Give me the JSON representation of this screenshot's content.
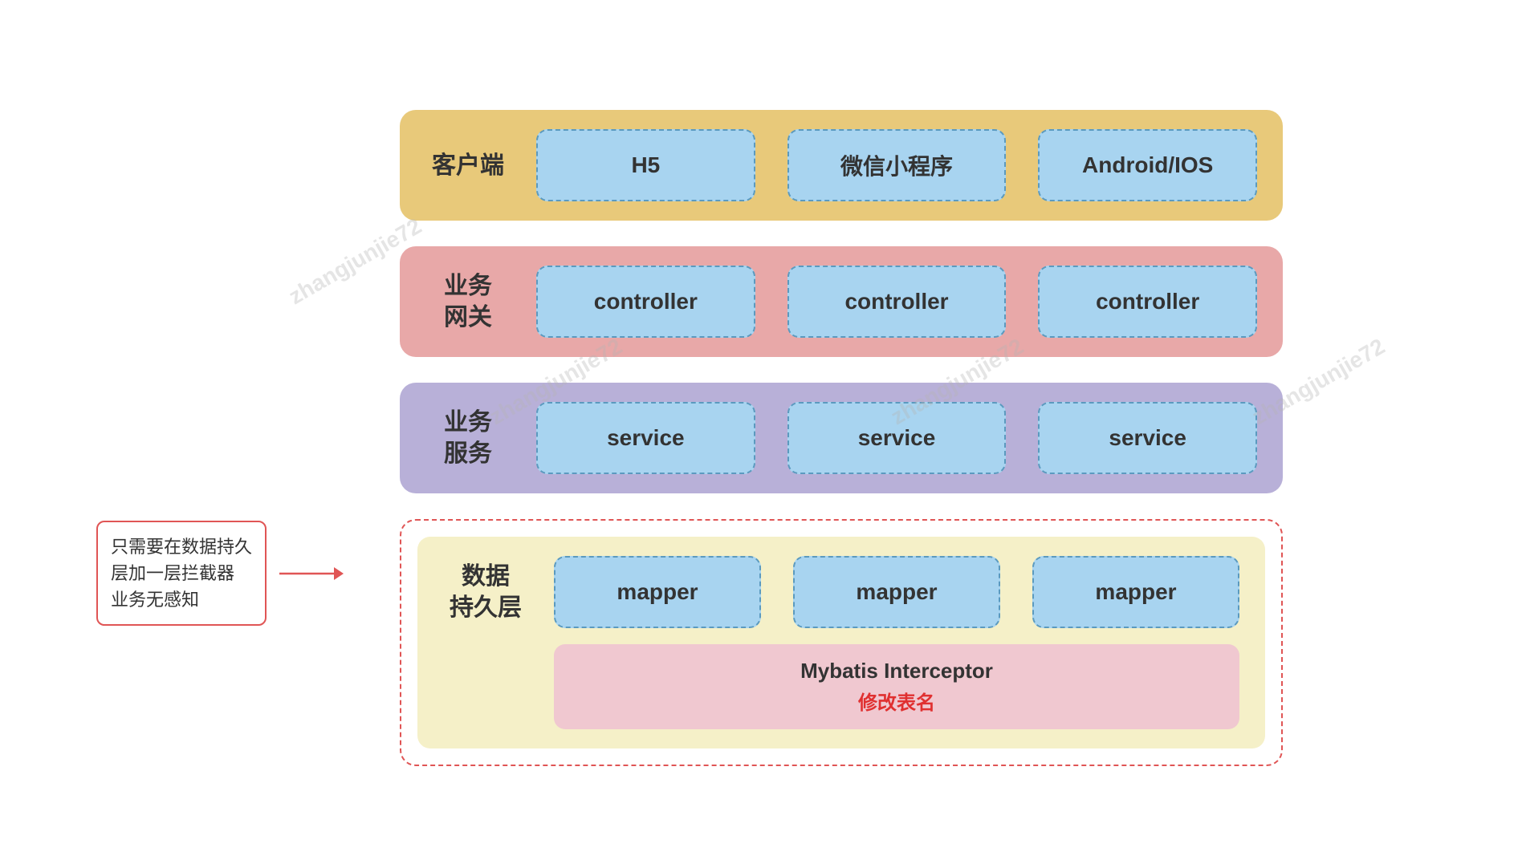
{
  "watermarks": [
    "zhangjunjie72",
    "zhangjunjie72",
    "zhangjunjie72",
    "zhangjunjie72"
  ],
  "layers": {
    "client": {
      "label": "客户端",
      "cards": [
        "H5",
        "微信小程序",
        "Android/IOS"
      ],
      "bg": "#e8c97a"
    },
    "gateway": {
      "label": "业务\n网关",
      "cards": [
        "controller",
        "controller",
        "controller"
      ],
      "bg": "#e8a8a8"
    },
    "service": {
      "label": "业务\n服务",
      "cards": [
        "service",
        "service",
        "service"
      ],
      "bg": "#b8b0d8"
    },
    "data": {
      "label": "数据\n持久层",
      "mappers": [
        "mapper",
        "mapper",
        "mapper"
      ],
      "interceptor_title": "Mybatis Interceptor",
      "interceptor_subtitle": "修改表名",
      "bg": "#f5f0c8"
    }
  },
  "annotation": {
    "text_line1": "只需要在数据持久",
    "text_line2": "层加一层拦截器",
    "text_line3": "业务无感知"
  }
}
